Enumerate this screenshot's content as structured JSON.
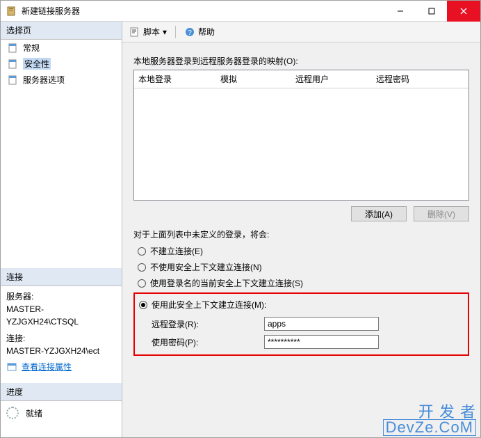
{
  "window": {
    "title": "新建链接服务器"
  },
  "toolbar": {
    "script": "脚本",
    "help": "帮助"
  },
  "sidebar": {
    "select_page": "选择页",
    "items": [
      {
        "label": "常规"
      },
      {
        "label": "安全性"
      },
      {
        "label": "服务器选项"
      }
    ],
    "connection_head": "连接",
    "server_label": "服务器:",
    "server_value": "MASTER-YZJGXH24\\CTSQL",
    "conn_label": "连接:",
    "conn_value": "MASTER-YZJGXH24\\ect",
    "view_props": "查看连接属性",
    "progress_head": "进度",
    "ready": "就绪"
  },
  "main": {
    "mapping_label": "本地服务器登录到远程服务器登录的映射(O):",
    "columns": [
      "本地登录",
      "模拟",
      "远程用户",
      "远程密码"
    ],
    "add_btn": "添加(A)",
    "delete_btn": "删除(V)",
    "undefined_label": "对于上面列表中未定义的登录，将会:",
    "radios": {
      "r1": "不建立连接(E)",
      "r2": "不使用安全上下文建立连接(N)",
      "r3": "使用登录名的当前安全上下文建立连接(S)",
      "r4": "使用此安全上下文建立连接(M):"
    },
    "remote_login_lbl": "远程登录(R):",
    "remote_login_val": "apps",
    "password_lbl": "使用密码(P):",
    "password_val": "**********"
  },
  "watermark": {
    "l1": "开 发 者",
    "l2": "DevZe.CoM"
  }
}
